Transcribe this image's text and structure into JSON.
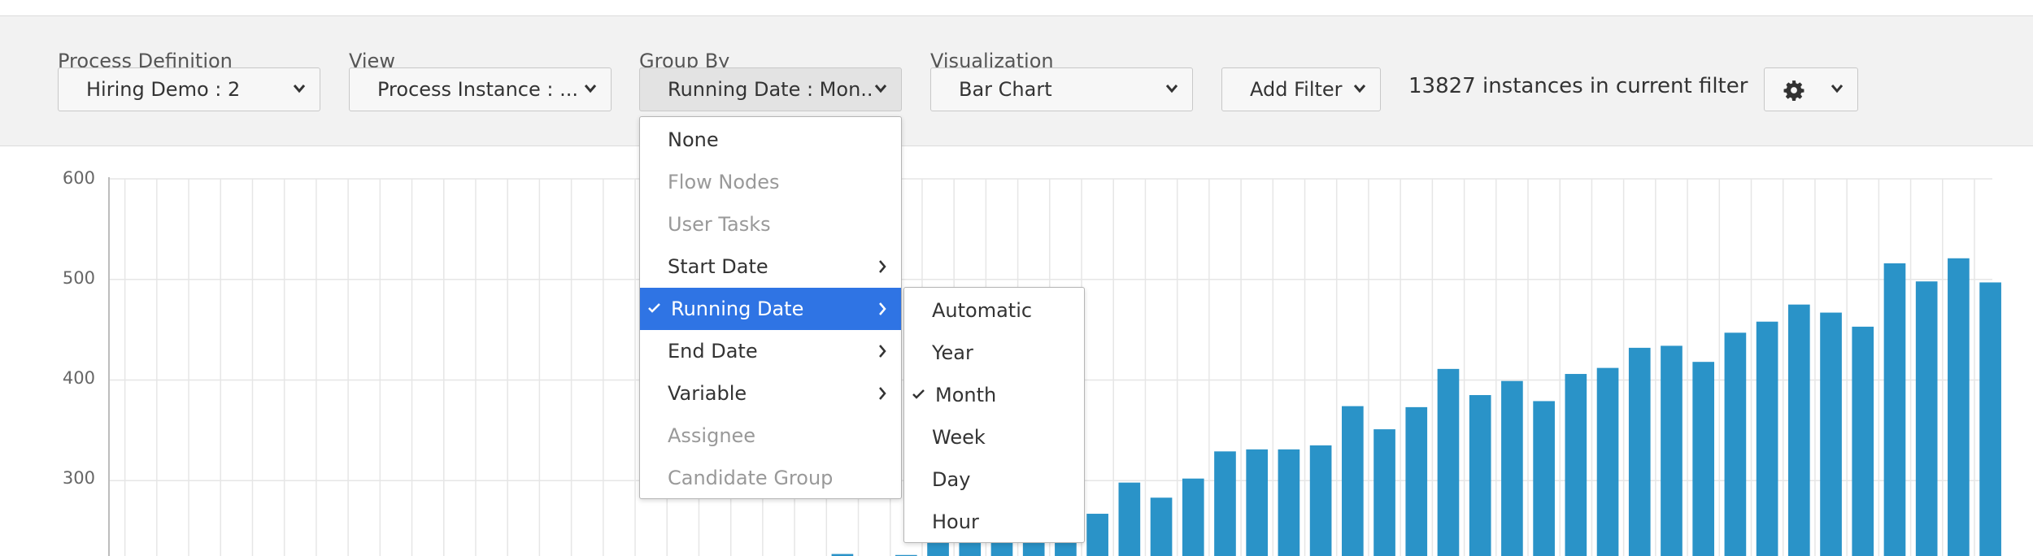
{
  "controls": {
    "process_definition": {
      "label": "Process Definition",
      "value": "Hiring Demo : 2"
    },
    "view": {
      "label": "View",
      "value": "Process Instance : ..."
    },
    "group_by": {
      "label": "Group By",
      "value": "Running Date : Mon..."
    },
    "visualization": {
      "label": "Visualization",
      "value": "Bar Chart"
    },
    "add_filter": {
      "label": "Add Filter"
    },
    "instance_count": "13827 instances in current filter",
    "settings_icon": "gear-icon"
  },
  "group_by_menu": {
    "items": [
      {
        "label": "None",
        "state": "normal",
        "submenu": false
      },
      {
        "label": "Flow Nodes",
        "state": "disabled",
        "submenu": false
      },
      {
        "label": "User Tasks",
        "state": "disabled",
        "submenu": false
      },
      {
        "label": "Start Date",
        "state": "normal",
        "submenu": true
      },
      {
        "label": "Running Date",
        "state": "selected",
        "submenu": true
      },
      {
        "label": "End Date",
        "state": "normal",
        "submenu": true
      },
      {
        "label": "Variable",
        "state": "normal",
        "submenu": true
      },
      {
        "label": "Assignee",
        "state": "disabled",
        "submenu": false
      },
      {
        "label": "Candidate Group",
        "state": "disabled",
        "submenu": false
      }
    ]
  },
  "date_submenu": {
    "items": [
      {
        "label": "Automatic",
        "checked": false
      },
      {
        "label": "Year",
        "checked": false
      },
      {
        "label": "Month",
        "checked": true
      },
      {
        "label": "Week",
        "checked": false
      },
      {
        "label": "Day",
        "checked": false
      },
      {
        "label": "Hour",
        "checked": false
      }
    ]
  },
  "colors": {
    "bar": "#2a93c8",
    "selected_item": "#2f74e4",
    "grid": "#e6e6e6"
  },
  "chart_data": {
    "type": "bar",
    "y_ticks": [
      "600",
      "500",
      "400",
      "300"
    ],
    "ylim": [
      225,
      600
    ],
    "grid": true,
    "values": [
      null,
      null,
      null,
      null,
      null,
      null,
      null,
      null,
      null,
      null,
      null,
      null,
      null,
      null,
      null,
      null,
      null,
      null,
      null,
      null,
      null,
      null,
      227,
      null,
      226,
      250,
      250,
      250,
      250,
      250,
      267,
      298,
      283,
      302,
      329,
      331,
      331,
      335,
      374,
      351,
      373,
      411,
      385,
      399,
      379,
      406,
      412,
      432,
      434,
      418,
      447,
      458,
      475,
      467,
      453,
      516,
      498,
      521,
      497
    ]
  }
}
